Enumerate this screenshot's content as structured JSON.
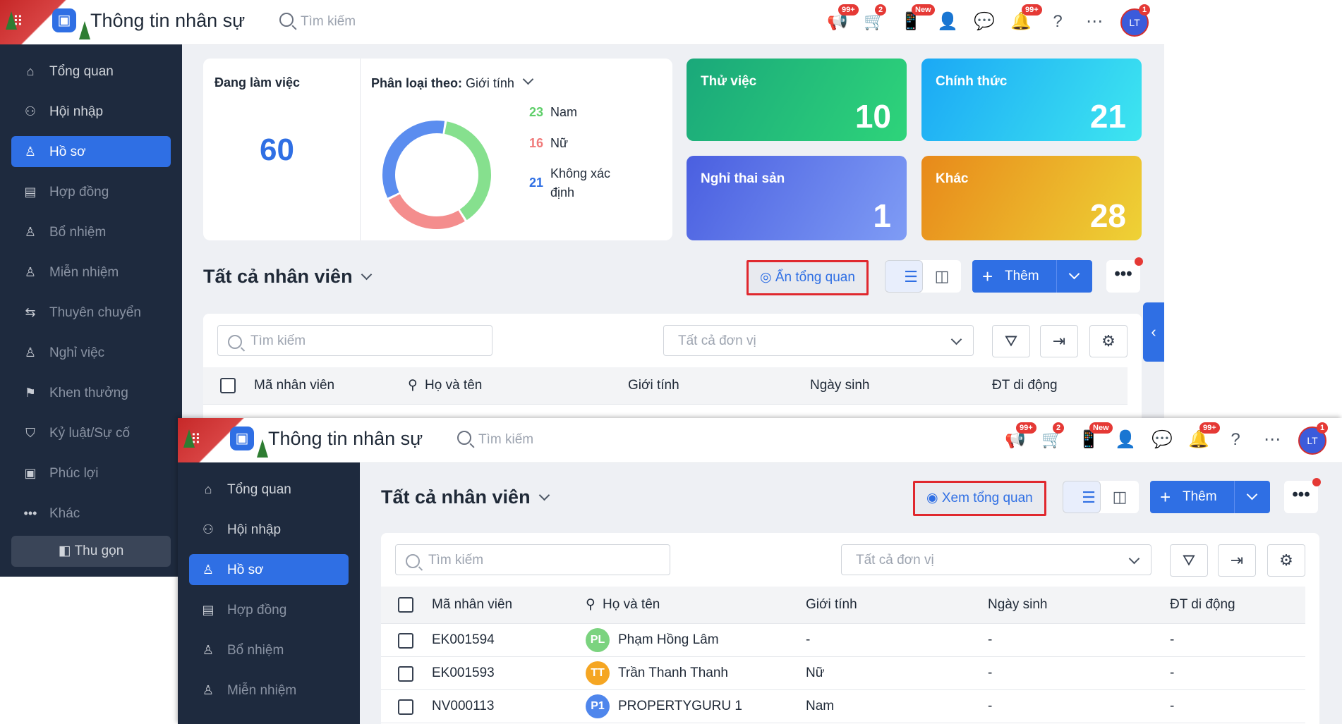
{
  "app": {
    "title": "Thông tin nhân sự",
    "search_placeholder": "Tìm kiếm",
    "user_initials": "LT"
  },
  "topbar_icons": [
    {
      "icon": "megaphone-icon",
      "badge": "99+"
    },
    {
      "icon": "cart-icon",
      "badge": "2"
    },
    {
      "icon": "phone-icon",
      "badge": "New"
    },
    {
      "icon": "add-user-icon",
      "badge": ""
    },
    {
      "icon": "chat-icon",
      "badge": ""
    },
    {
      "icon": "bell-icon",
      "badge": "99+"
    },
    {
      "icon": "help-icon",
      "badge": ""
    },
    {
      "icon": "more-circle-icon",
      "badge": ""
    }
  ],
  "avatar_badge": "1",
  "sidebar": {
    "items": [
      {
        "icon": "home-icon",
        "label": "Tổng quan"
      },
      {
        "icon": "onboarding-icon",
        "label": "Hội nhập"
      },
      {
        "icon": "profile-icon",
        "label": "Hồ sơ"
      },
      {
        "icon": "contract-icon",
        "label": "Hợp đồng"
      },
      {
        "icon": "appoint-icon",
        "label": "Bổ nhiệm"
      },
      {
        "icon": "dismiss-icon",
        "label": "Miễn nhiệm"
      },
      {
        "icon": "transfer-icon",
        "label": "Thuyên chuyển"
      },
      {
        "icon": "resign-icon",
        "label": "Nghỉ việc"
      },
      {
        "icon": "reward-icon",
        "label": "Khen thưởng"
      },
      {
        "icon": "discipline-icon",
        "label": "Kỷ luật/Sự cố"
      },
      {
        "icon": "benefit-icon",
        "label": "Phúc lợi"
      },
      {
        "icon": "more-dots-icon",
        "label": "Khác"
      }
    ],
    "collapse_label": "Thu gọn",
    "active_index": 2
  },
  "overview": {
    "working_label": "Đang làm việc",
    "working_count": "60",
    "classify_label": "Phân loại theo:",
    "classify_value": "Giới tính",
    "gender": [
      {
        "count": "23",
        "label": "Nam",
        "color": "#86e08e",
        "value": 23
      },
      {
        "count": "16",
        "label": "Nữ",
        "color": "#f48d8d",
        "value": 16
      },
      {
        "count": "21",
        "label": "Không xác định",
        "color": "#5b8def",
        "value": 21
      }
    ],
    "stats": [
      {
        "label": "Thử việc",
        "value": "10"
      },
      {
        "label": "Chính thức",
        "value": "21"
      },
      {
        "label": "Nghỉ thai sản",
        "value": "1"
      },
      {
        "label": "Khác",
        "value": "28"
      }
    ]
  },
  "list": {
    "title": "Tất cả nhân viên",
    "hide_overview_label": "Ẩn tổng quan",
    "show_overview_label": "Xem tổng quan",
    "add_label": "Thêm",
    "more_label": "•••",
    "search_placeholder": "Tìm kiếm",
    "unit_placeholder": "Tất cả đơn vị",
    "columns": [
      "Mã nhân viên",
      "Họ và tên",
      "Giới tính",
      "Ngày sinh",
      "ĐT di động"
    ],
    "rows": [
      {
        "code": "EK001594",
        "initials": "PL",
        "color": "#7bd37f",
        "name": "Phạm Hồng Lâm",
        "gender": "-",
        "dob": "-",
        "phone": "-"
      },
      {
        "code": "EK001593",
        "initials": "TT",
        "color": "#f5a623",
        "name": "Trần Thanh Thanh",
        "gender": "Nữ",
        "dob": "-",
        "phone": "-"
      },
      {
        "code": "NV000113",
        "initials": "P1",
        "color": "#4f86ec",
        "name": "PROPERTYGURU 1",
        "gender": "Nam",
        "dob": "-",
        "phone": "-"
      }
    ]
  }
}
